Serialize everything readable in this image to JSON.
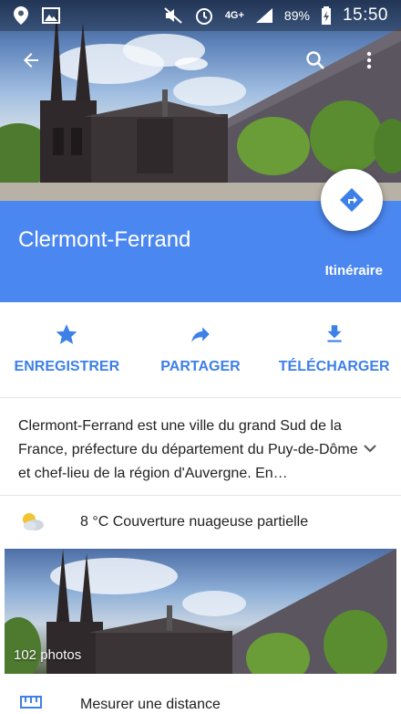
{
  "status_bar": {
    "battery": "89%",
    "network": "4G+",
    "time": "15:50"
  },
  "place": {
    "name": "Clermont-Ferrand",
    "directions_label": "Itinéraire"
  },
  "actions": [
    {
      "label": "ENREGISTRER",
      "icon": "star-icon"
    },
    {
      "label": "PARTAGER",
      "icon": "share-icon"
    },
    {
      "label": "TÉLÉCHARGER",
      "icon": "download-icon"
    }
  ],
  "description": "Clermont-Ferrand est une ville du grand Sud de la France, préfecture du département du Puy-de-Dôme et chef-lieu de la région d'Auvergne. En…",
  "weather": {
    "text": "8 °C Couverture nuageuse partielle",
    "icon": "partly-cloudy-icon"
  },
  "photos": {
    "count_label": "102 photos"
  },
  "measure": {
    "label": "Mesurer une distance",
    "icon": "ruler-icon"
  },
  "colors": {
    "header_blue": "#4b87f0",
    "accent_blue": "#3d80e8"
  }
}
